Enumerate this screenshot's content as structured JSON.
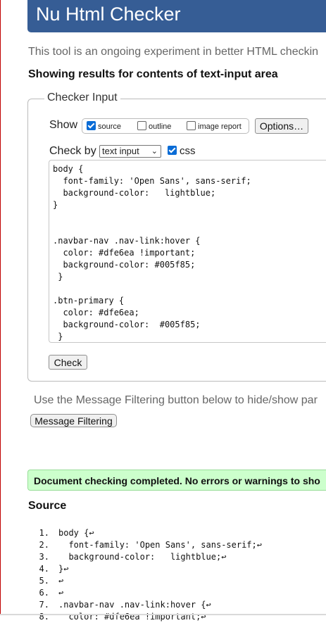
{
  "header": {
    "title": "Nu Html Checker"
  },
  "intro_text": "This tool is an ongoing experiment in better HTML checkin",
  "results_heading": "Showing results for contents of text-input area",
  "checker_input": {
    "legend": "Checker Input",
    "show_label": "Show",
    "options": [
      {
        "label": "source",
        "checked": true
      },
      {
        "label": "outline",
        "checked": false
      },
      {
        "label": "image report",
        "checked": false
      }
    ],
    "options_button": "Options…",
    "check_by_label": "Check by",
    "check_by_value": "text input",
    "css_label": "css",
    "css_checked": true,
    "code": "body {\n  font-family: 'Open Sans', sans-serif;\n  background-color:   lightblue;\n}\n\n\n.navbar-nav .nav-link:hover {\n  color: #dfe6ea !important;\n  background-color: #005f85;\n }\n\n.btn-primary {\n  color: #dfe6ea;\n  background-color:  #005f85;\n }",
    "check_button": "Check"
  },
  "filter_text": "Use the Message Filtering button below to hide/show par",
  "filter_button": "Message Filtering",
  "success_message": "Document checking completed. No errors or warnings to sho",
  "source_heading": "Source",
  "source_lines": [
    {
      "num": "1.",
      "code": "body {↩"
    },
    {
      "num": "2.",
      "code": "  font-family: 'Open Sans', sans-serif;↩"
    },
    {
      "num": "3.",
      "code": "  background-color:   lightblue;↩"
    },
    {
      "num": "4.",
      "code": "}↩"
    },
    {
      "num": "5.",
      "code": "↩"
    },
    {
      "num": "6.",
      "code": "↩"
    },
    {
      "num": "7.",
      "code": ".navbar-nav .nav-link:hover {↩"
    },
    {
      "num": "8.",
      "code": "  color: #dfe6ea !important;↩"
    }
  ],
  "colors": {
    "header_bg": "#365d95",
    "success_bg": "#ccffcc",
    "checkbox_accent": "#0a6cd6"
  }
}
